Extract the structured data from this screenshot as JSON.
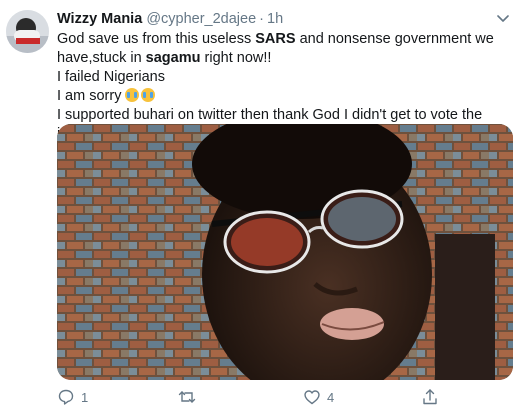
{
  "tweet": {
    "display_name": "Wizzy Mania",
    "handle": "@cypher_2dajee",
    "separator": "·",
    "time": "1h",
    "lines": {
      "line1_pre": "God save us from this useless ",
      "line1_bold": "SARS",
      "line1_post": " and nonsense government we",
      "line2_pre": "have,stuck in ",
      "line2_bold": "sagamu",
      "line2_post": " right now!!",
      "line3": "I failed Nigerians",
      "line4": "I am sorry",
      "line5": "I supported buhari on twitter then thank God I didn't get to vote the idiot."
    },
    "emoji": [
      "crying-face",
      "crying-face"
    ]
  },
  "actions": {
    "reply_count": "1",
    "retweet_count": "",
    "like_count": "4"
  },
  "colors": {
    "text": "#14171a",
    "muted": "#657786",
    "border": "#e6ecf0"
  }
}
